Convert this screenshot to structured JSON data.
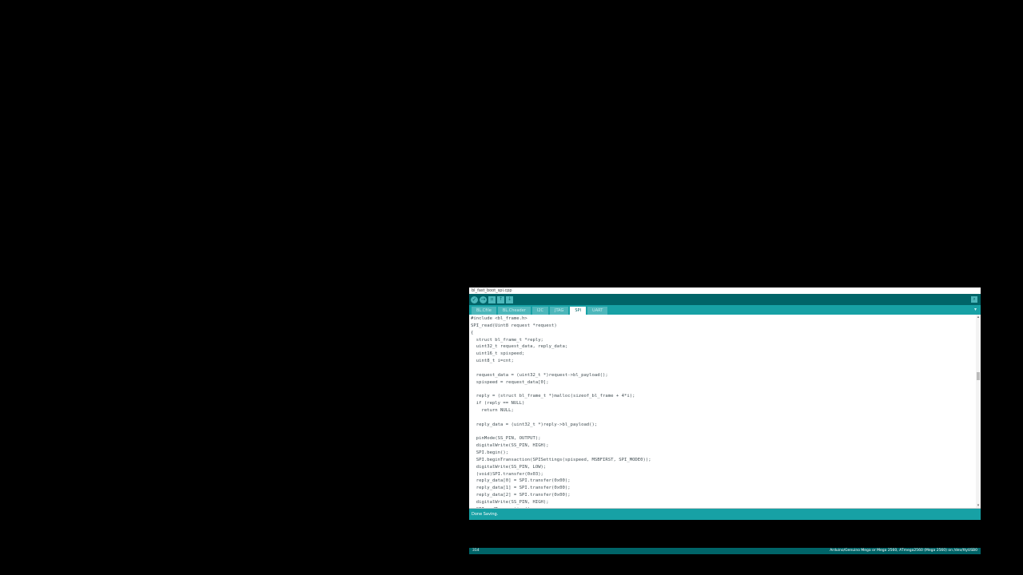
{
  "window": {
    "title": "bl_fast_boot_spi.cpp"
  },
  "toolbar": {
    "verify_icon": "check-icon",
    "upload_icon": "arrow-right-icon",
    "new_icon": "new-file-icon",
    "open_icon": "arrow-up-icon",
    "save_icon": "arrow-down-icon",
    "serial_monitor_icon": "magnifier-icon"
  },
  "tabs": [
    {
      "label": "BL.Cfile"
    },
    {
      "label": "BL.Cheader"
    },
    {
      "label": "I2C"
    },
    {
      "label": "JTAG"
    },
    {
      "label": "SPI"
    },
    {
      "label": "UART"
    }
  ],
  "active_tab": 4,
  "code_lines": [
    "#include <bl_frame.h>",
    "SPI_read(Uint8 request *request)",
    "{",
    "  struct bl_frame_t *reply;",
    "  uint32_t request_data, reply_data;",
    "  uint16_t spispeed;",
    "  uint8_t i=cnt;",
    "",
    "  request_data = (uint32_t *)request->bl_payload();",
    "  spispeed = request_data[0];",
    "",
    "  reply = (struct bl_frame_t *)malloc(sizeof_bl_frame + 4*i);",
    "  if (reply == NULL)",
    "    return NULL;",
    "",
    "  reply_data = (uint32_t *)reply->bl_payload();",
    "",
    "  pinMode(SS_PIN, OUTPUT);",
    "  digitalWrite(SS_PIN, HIGH);",
    "  SPI.begin();",
    "  SPI.beginTransaction(SPISettings(spispeed, MSBFIRST, SPI_MODE0));",
    "  digitalWrite(SS_PIN, LOW);",
    "  (void)SPI.transfer(0x03);",
    "  reply_data[0] = SPI.transfer(0x00);",
    "  reply_data[1] = SPI.transfer(0x00);",
    "  reply_data[2] = SPI.transfer(0x00);",
    "  digitalWrite(SS_PIN, HIGH);",
    "  SPI.endTransaction();"
  ],
  "status": {
    "text": "Done Saving."
  },
  "console": {
    "line": "314",
    "board": "Arduino/Genuino Mega or Mega 2560, ATmega2560 (Mega 2560) on /dev/ttyUSB0"
  },
  "colors": {
    "toolbar": "#006468",
    "tabbar": "#17a1a5",
    "status": "#17a1a5",
    "background": "#000000"
  }
}
